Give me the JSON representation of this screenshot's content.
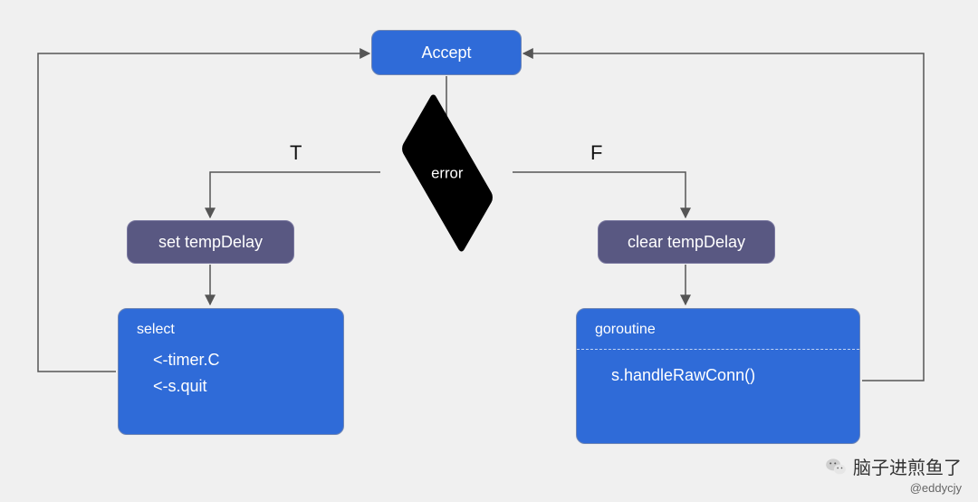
{
  "nodes": {
    "accept": "Accept",
    "error": "error",
    "setTemp": "set tempDelay",
    "clearTemp": "clear tempDelay",
    "selectTitle": "select",
    "selectLines": [
      "<-timer.C",
      "<-s.quit"
    ],
    "goroutineTitle": "goroutine",
    "goroutineLine": "s.handleRawConn()"
  },
  "labels": {
    "true": "T",
    "false": "F"
  },
  "watermark": {
    "text": "脑子进煎鱼了",
    "handle": "@eddycjy"
  }
}
